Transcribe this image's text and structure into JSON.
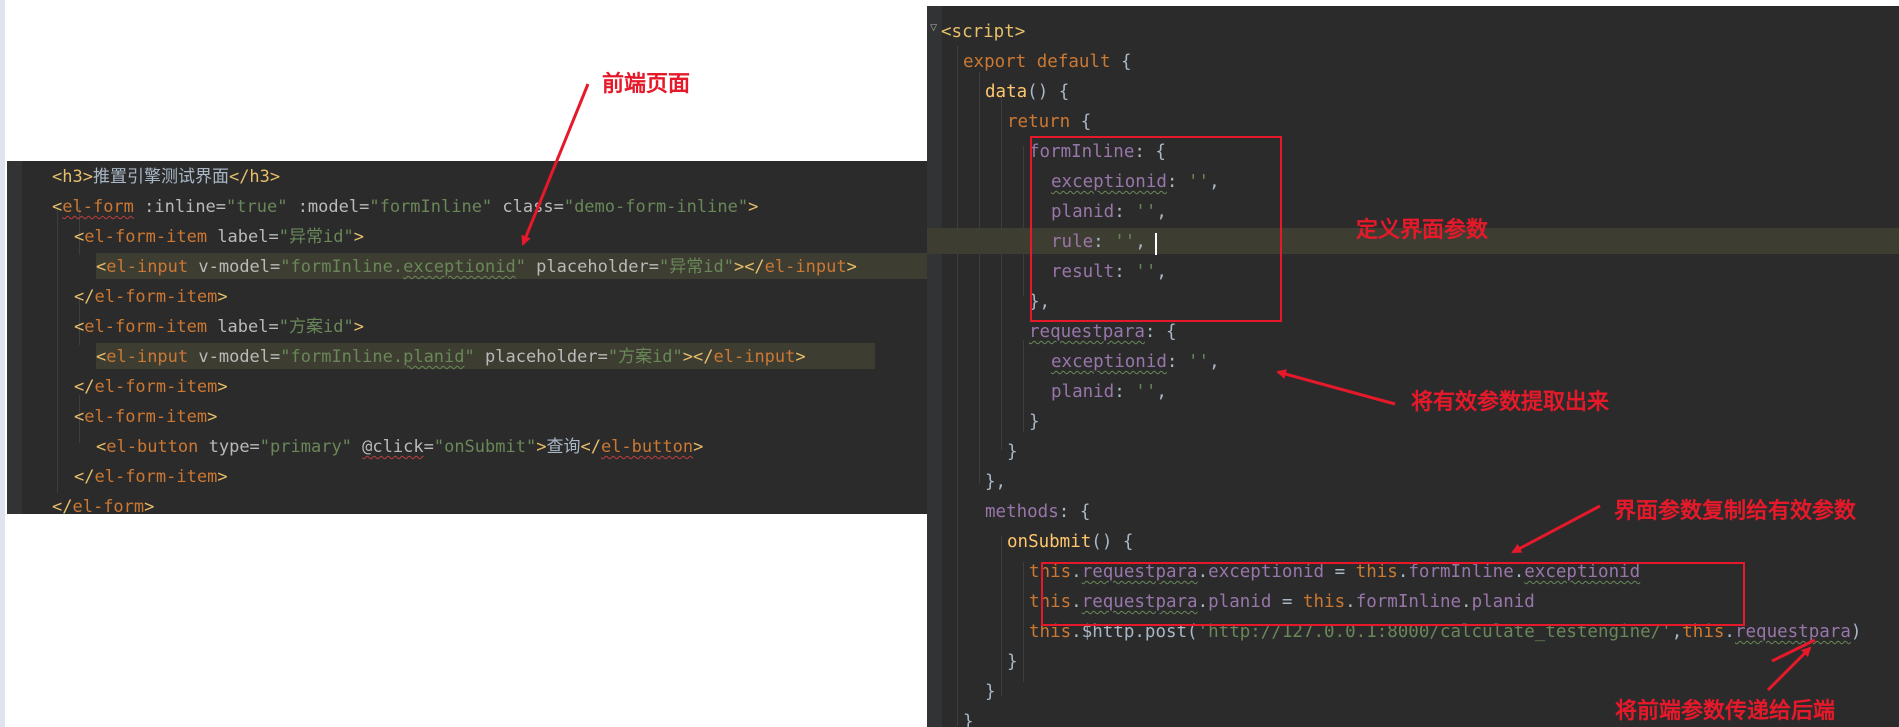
{
  "left_code": [
    [
      [
        "c-tag",
        "<h3>"
      ],
      [
        "c-plain",
        "推置引擎测试界面"
      ],
      [
        "c-tag",
        "</h3>"
      ]
    ],
    [
      [
        "c-tag",
        "<"
      ],
      [
        "c-comp sqr",
        "el-form"
      ],
      [
        "c-attr",
        " :inline="
      ],
      [
        "c-str",
        "\"true\""
      ],
      [
        "c-attr",
        " :model="
      ],
      [
        "c-str",
        "\"formInline\""
      ],
      [
        "c-attr",
        " class="
      ],
      [
        "c-str",
        "\"demo-form-inline\""
      ],
      [
        "c-tag",
        ">"
      ]
    ],
    [
      [
        "c-tag",
        "<"
      ],
      [
        "c-comp",
        "el-form-item"
      ],
      [
        "c-attr",
        " label="
      ],
      [
        "c-str",
        "\"异常id\""
      ],
      [
        "c-tag",
        ">"
      ]
    ],
    [
      [
        "c-tag",
        "<"
      ],
      [
        "c-comp",
        "el-input"
      ],
      [
        "c-attr",
        " v-model="
      ],
      [
        "c-str",
        "\"formInline."
      ],
      [
        "c-str sq",
        "exceptionid"
      ],
      [
        "c-str",
        "\""
      ],
      [
        "c-attr",
        " placeholder="
      ],
      [
        "c-str",
        "\"异常id\""
      ],
      [
        "c-tag",
        "></"
      ],
      [
        "c-comp",
        "el-input"
      ],
      [
        "c-tag",
        ">"
      ]
    ],
    [
      [
        "c-tag",
        "</"
      ],
      [
        "c-comp",
        "el-form-item"
      ],
      [
        "c-tag",
        ">"
      ]
    ],
    [
      [
        "c-tag",
        "<"
      ],
      [
        "c-comp",
        "el-form-item"
      ],
      [
        "c-attr",
        " label="
      ],
      [
        "c-str",
        "\"方案id\""
      ],
      [
        "c-tag",
        ">"
      ]
    ],
    [
      [
        "c-tag",
        "<"
      ],
      [
        "c-comp",
        "el-input"
      ],
      [
        "c-attr",
        " v-model="
      ],
      [
        "c-str",
        "\"formInline."
      ],
      [
        "c-str sq",
        "planid"
      ],
      [
        "c-str",
        "\""
      ],
      [
        "c-attr",
        " placeholder="
      ],
      [
        "c-str",
        "\"方案id\""
      ],
      [
        "c-tag",
        "></"
      ],
      [
        "c-comp",
        "el-input"
      ],
      [
        "c-tag",
        ">"
      ]
    ],
    [
      [
        "c-tag",
        "</"
      ],
      [
        "c-comp",
        "el-form-item"
      ],
      [
        "c-tag",
        ">"
      ]
    ],
    [
      [
        "c-tag",
        "<"
      ],
      [
        "c-comp",
        "el-form-item"
      ],
      [
        "c-tag",
        ">"
      ]
    ],
    [
      [
        "c-tag",
        "<"
      ],
      [
        "c-comp",
        "el-button"
      ],
      [
        "c-attr",
        " type="
      ],
      [
        "c-str",
        "\"primary\""
      ],
      [
        "c-attr",
        " "
      ],
      [
        "c-attr sqr",
        "@click"
      ],
      [
        "c-attr",
        "="
      ],
      [
        "c-str",
        "\"onSubmit\""
      ],
      [
        "c-tag",
        ">"
      ],
      [
        "c-plain",
        "查询"
      ],
      [
        "c-tag",
        "</"
      ],
      [
        "c-comp sqr",
        "el-button"
      ],
      [
        "c-tag",
        ">"
      ]
    ],
    [
      [
        "c-tag",
        "</"
      ],
      [
        "c-comp",
        "el-form-item"
      ],
      [
        "c-tag",
        ">"
      ]
    ],
    [
      [
        "c-tag",
        "</"
      ],
      [
        "c-comp sqr",
        "el-form"
      ],
      [
        "c-tag",
        ">"
      ]
    ]
  ],
  "right_code": [
    [
      [
        "c-tag",
        "<script>"
      ]
    ],
    [
      [
        "c-kw",
        "export default"
      ],
      [
        "c-plain",
        " {"
      ]
    ],
    [
      [
        "c-fn",
        "data"
      ],
      [
        "c-plain",
        "() {"
      ]
    ],
    [
      [
        "c-kw",
        "return"
      ],
      [
        "c-plain",
        " {"
      ]
    ],
    [
      [
        "c-field",
        "formInline"
      ],
      [
        "c-plain",
        ": {"
      ]
    ],
    [
      [
        "c-field sq",
        "exceptionid"
      ],
      [
        "c-plain",
        ": "
      ],
      [
        "c-str",
        "''"
      ],
      [
        "c-plain",
        ","
      ]
    ],
    [
      [
        "c-field",
        "planid"
      ],
      [
        "c-plain",
        ": "
      ],
      [
        "c-str",
        "''"
      ],
      [
        "c-plain",
        ","
      ]
    ],
    [
      [
        "c-field",
        "rule"
      ],
      [
        "c-plain",
        ": "
      ],
      [
        "c-str",
        "''"
      ],
      [
        "c-plain",
        ","
      ]
    ],
    [
      [
        "c-field",
        "result"
      ],
      [
        "c-plain",
        ": "
      ],
      [
        "c-str",
        "''"
      ],
      [
        "c-plain",
        ","
      ]
    ],
    [
      [
        "c-plain",
        "},"
      ]
    ],
    [
      [
        "c-field sq",
        "requestpara"
      ],
      [
        "c-plain",
        ": {"
      ]
    ],
    [
      [
        "c-field sq",
        "exceptionid"
      ],
      [
        "c-plain",
        ": "
      ],
      [
        "c-str",
        "''"
      ],
      [
        "c-plain",
        ","
      ]
    ],
    [
      [
        "c-field",
        "planid"
      ],
      [
        "c-plain",
        ": "
      ],
      [
        "c-str",
        "''"
      ],
      [
        "c-plain",
        ","
      ]
    ],
    [
      [
        "c-plain",
        "}"
      ]
    ],
    [
      [
        "c-plain",
        "}"
      ]
    ],
    [
      [
        "c-plain",
        "},"
      ]
    ],
    [
      [
        "c-field",
        "methods"
      ],
      [
        "c-plain",
        ": {"
      ]
    ],
    [
      [
        "c-fn",
        "onSubmit"
      ],
      [
        "c-plain",
        "() {"
      ]
    ],
    [
      [
        "c-kw",
        "this"
      ],
      [
        "c-plain",
        "."
      ],
      [
        "c-field sq",
        "requestpara"
      ],
      [
        "c-plain",
        "."
      ],
      [
        "c-field",
        "exceptionid"
      ],
      [
        "c-plain",
        " = "
      ],
      [
        "c-kw",
        "this"
      ],
      [
        "c-plain",
        "."
      ],
      [
        "c-field",
        "formInline"
      ],
      [
        "c-plain",
        "."
      ],
      [
        "c-field sq",
        "exceptionid"
      ]
    ],
    [
      [
        "c-kw",
        "this"
      ],
      [
        "c-plain",
        "."
      ],
      [
        "c-field sq",
        "requestpara"
      ],
      [
        "c-plain",
        "."
      ],
      [
        "c-field",
        "planid"
      ],
      [
        "c-plain",
        " = "
      ],
      [
        "c-kw",
        "this"
      ],
      [
        "c-plain",
        "."
      ],
      [
        "c-field",
        "formInline"
      ],
      [
        "c-plain",
        "."
      ],
      [
        "c-field",
        "planid"
      ]
    ],
    [
      [
        "c-kw",
        "this"
      ],
      [
        "c-plain",
        ".$http.post("
      ],
      [
        "c-str",
        "'http://127.0.0.1:8000/calculate_testengine/'"
      ],
      [
        "c-plain",
        ","
      ],
      [
        "c-kw",
        "this"
      ],
      [
        "c-plain",
        "."
      ],
      [
        "c-field sq",
        "requestpara"
      ],
      [
        "c-plain",
        ")"
      ]
    ],
    [
      [
        "c-plain",
        "}"
      ]
    ],
    [
      [
        "c-plain",
        "}"
      ]
    ],
    [
      [
        "c-plain",
        "}"
      ]
    ]
  ],
  "annotations": {
    "frontend_page": "前端页面",
    "define_params": "定义界面参数",
    "extract_params": "将有效参数提取出来",
    "copy_params": "界面参数复制给有效参数",
    "send_params": "将前端参数传递给后端"
  },
  "colors": {
    "annotation_red": "#e6192a",
    "editor_bg": "#2b2b2b"
  }
}
